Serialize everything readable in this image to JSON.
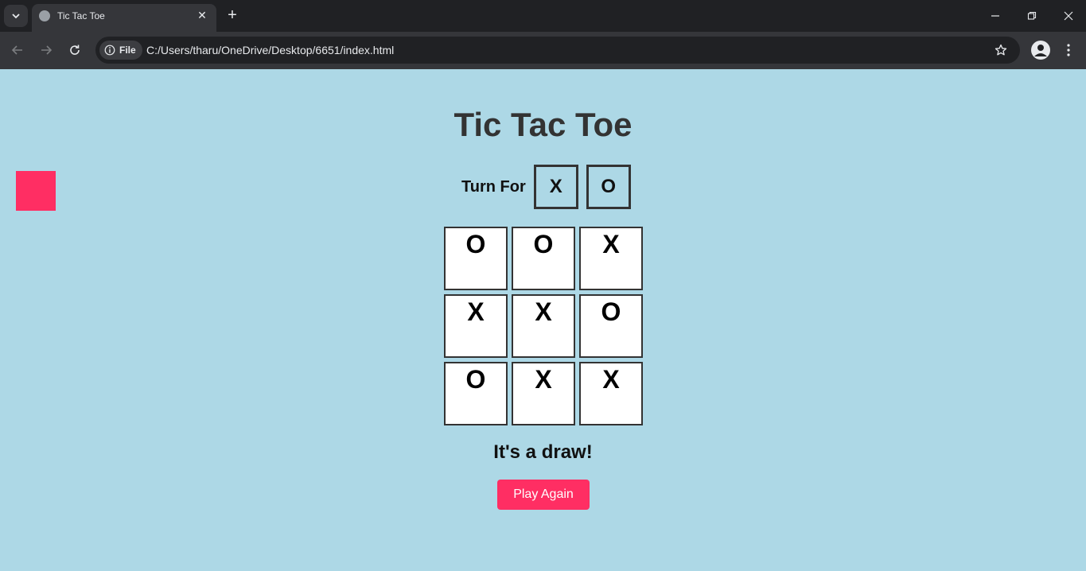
{
  "browser": {
    "tab_title": "Tic Tac Toe",
    "omnibox": {
      "chip_label": "File",
      "url": "C:/Users/tharu/OneDrive/Desktop/6651/index.html"
    },
    "icons": [
      "tab-list-icon",
      "globe-icon",
      "close-icon",
      "plus-icon",
      "minimize-icon",
      "restore-icon",
      "back-icon",
      "forward-icon",
      "reload-icon",
      "info-icon",
      "star-icon",
      "profile-icon",
      "kebab-menu-icon"
    ]
  },
  "game": {
    "title": "Tic Tac Toe",
    "turn_label": "Turn For",
    "turn_x": "X",
    "turn_o": "O",
    "board": [
      "O",
      "O",
      "X",
      "X",
      "X",
      "O",
      "O",
      "X",
      "X"
    ],
    "result": "It's a draw!",
    "play_again_label": "Play Again",
    "colors": {
      "background": "#add8e6",
      "accent": "#ff2e63",
      "text": "#333333"
    }
  }
}
